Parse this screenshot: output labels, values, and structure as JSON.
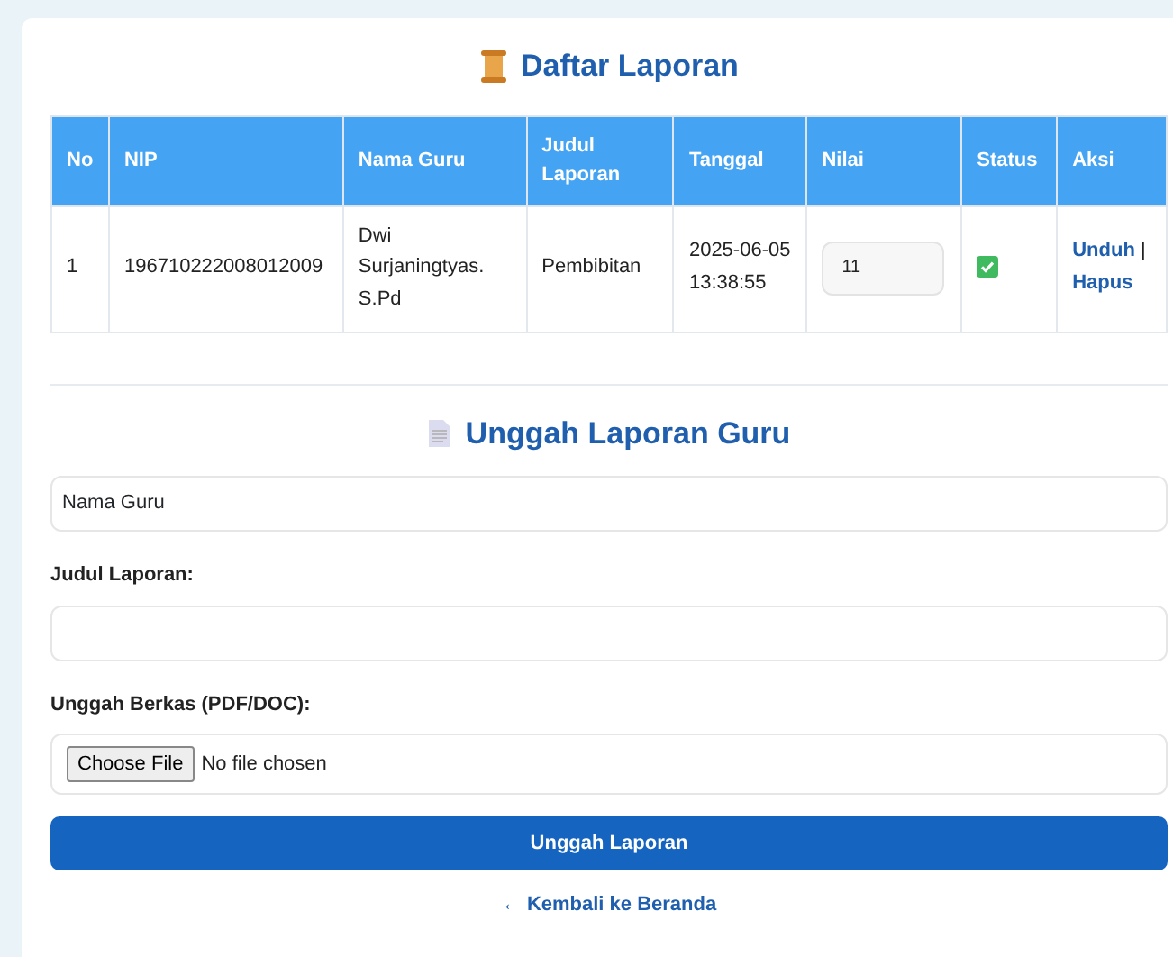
{
  "report_list": {
    "title": "Daftar Laporan",
    "columns": [
      "No",
      "NIP",
      "Nama Guru",
      "Judul Laporan",
      "Tanggal",
      "Nilai",
      "Status",
      "Aksi"
    ],
    "rows": [
      {
        "no": "1",
        "nip": "196710222008012009",
        "name": "Dwi Surjaningtyas. S.Pd",
        "title": "Pembibitan",
        "date": "2025-06-05 13:38:55",
        "score": "11",
        "status_checked": true,
        "actions": [
          "Unduh",
          "Hapus"
        ],
        "separator": "|"
      }
    ]
  },
  "upload_form": {
    "title": "Unggah Laporan Guru",
    "teacher_select": {
      "value": "Nama Guru"
    },
    "title_label": "Judul Laporan:",
    "file_label": "Unggah Berkas (PDF/DOC):",
    "file_button": "Choose File",
    "file_status": "No file chosen",
    "submit": "Unggah Laporan"
  },
  "back_link": {
    "arrow": "←",
    "label": "Kembali ke Beranda"
  }
}
